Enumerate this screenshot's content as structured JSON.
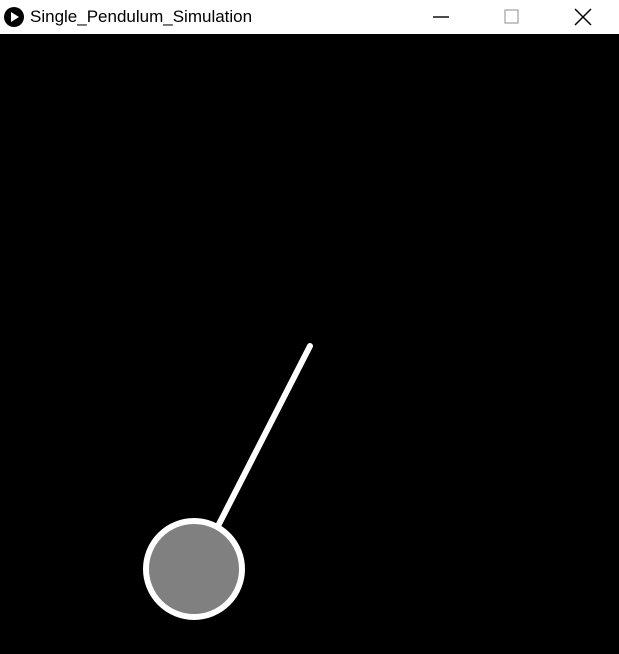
{
  "window": {
    "title": "Single_Pendulum_Simulation",
    "app_icon": "processing-play-icon",
    "controls": {
      "minimize_icon": "minimize-icon",
      "maximize_icon": "maximize-icon",
      "close_icon": "close-icon"
    }
  },
  "simulation": {
    "background_color": "#000000",
    "rod_color": "#ffffff",
    "bob_fill_color": "#808080",
    "bob_stroke_color": "#ffffff"
  }
}
